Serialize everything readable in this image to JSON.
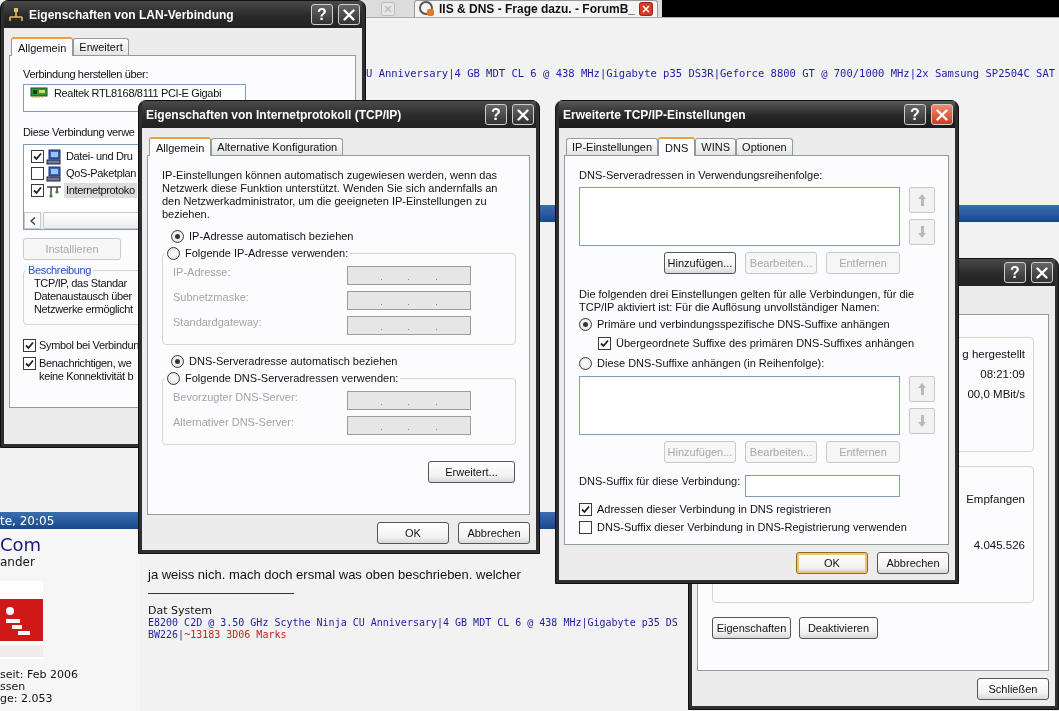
{
  "browser": {
    "tab_title": "IIS & DNS - Frage dazu. - ForumB_"
  },
  "forum": {
    "signature_fragment": "U Anniversary|4 GB MDT CL 6 @ 438 MHz|Gigabyte p35 DS3R|Geforce 8800 GT @ 700/1000 MHz|2x Samsung SP2504C SAT",
    "post_header": "te, 20:05",
    "user": {
      "name": "Com",
      "rank": "ander",
      "avatar": {
        "kind": "picture"
      },
      "details": [
        "seit: Feb 2006",
        "ssen",
        "ge: 2.053"
      ]
    },
    "post": {
      "text": "ja weiss nich. mach doch ersmal was oben beschrieben. welcher",
      "signature_title": "Dat System",
      "signature_lines": [
        {
          "segments": [
            {
              "text": "E8200 C2D @ 3.50 GHz Scythe Ninja CU Anniversary|4 GB MDT CL 6 @ 438 MHz|Gigabyte p35 DS",
              "color": "#1c1ca0"
            }
          ]
        },
        {
          "segments": [
            {
              "text": "BW226|",
              "color": "#1c1ca0"
            },
            {
              "text": "~13183 3D06 Marks",
              "color": "#c82020"
            }
          ]
        }
      ]
    }
  },
  "lan_window": {
    "title": "Eigenschaften von LAN-Verbindung",
    "active": false,
    "help": "?",
    "tabs": [
      {
        "label": "Allgemein",
        "selected": true
      },
      {
        "label": "Erweitert",
        "selected": false
      }
    ],
    "connect_label": "Verbindung herstellen über:",
    "adapter": "Realtek RTL8168/8111 PCI-E Gigabi",
    "components_label": "Diese Verbindung verwe",
    "components": [
      {
        "label": "Datei- und Dru",
        "kind": "computer",
        "checked": true,
        "selected": false
      },
      {
        "label": "QoS-Paketplan",
        "kind": "computer",
        "checked": false,
        "selected": false
      },
      {
        "label": "Internetprotoko",
        "kind": "protocol",
        "checked": true,
        "selected": true
      }
    ],
    "install_button": {
      "label": "Installieren",
      "disabled": true
    },
    "description": {
      "legend": "Beschreibung",
      "lines": [
        "TCP/IP, das Standar",
        "Datenaustausch über",
        "Netzwerke ermöglicht"
      ]
    },
    "options": [
      {
        "lines": [
          "Symbol bei Verbindun"
        ],
        "checked": true
      },
      {
        "lines": [
          "Benachrichtigen, we",
          "keine Konnektivität b"
        ],
        "checked": true
      }
    ]
  },
  "tcpip_window": {
    "title": "Eigenschaften von Internetprotokoll (TCP/IP)",
    "active": false,
    "help": "?",
    "tabs": [
      {
        "label": "Allgemein",
        "selected": true
      },
      {
        "label": "Alternative Konfiguration",
        "selected": false
      }
    ],
    "intro": "IP-Einstellungen können automatisch zugewiesen werden, wenn das Netzwerk diese Funktion unterstützt. Wenden Sie sich andernfalls an den Netzwerkadministrator, um die geeigneten IP-Einstellungen zu beziehen.",
    "ip_modes": [
      {
        "label": "IP-Adresse automatisch beziehen",
        "selected": true
      },
      {
        "label": "Folgende IP-Adresse verwenden:",
        "selected": false
      }
    ],
    "ip_fields": [
      {
        "label": "IP-Adresse:",
        "disabled": true
      },
      {
        "label": "Subnetzmaske:",
        "disabled": true
      },
      {
        "label": "Standardgateway:",
        "disabled": true
      }
    ],
    "dns_modes": [
      {
        "label": "DNS-Serveradresse automatisch beziehen",
        "selected": true
      },
      {
        "label": "Folgende DNS-Serveradressen verwenden:",
        "selected": false
      }
    ],
    "dns_fields": [
      {
        "label": "Bevorzugter DNS-Server:",
        "disabled": true
      },
      {
        "label": "Alternativer DNS-Server:",
        "disabled": true
      }
    ],
    "advanced_button": "Erweitert...",
    "buttons": [
      {
        "label": "OK",
        "default": false
      },
      {
        "label": "Abbrechen",
        "default": false
      }
    ]
  },
  "status_window": {
    "active": false,
    "help": "?",
    "status_values": [
      "g hergestellt",
      "08:21:09",
      "00,0 MBit/s"
    ],
    "activity_label": "Empfangen",
    "received": "4.045.526",
    "buttons": [
      {
        "label": "Eigenschaften"
      },
      {
        "label": "Deaktivieren"
      }
    ],
    "close_button": "Schließen"
  },
  "advanced_window": {
    "title": "Erweiterte TCP/IP-Einstellungen",
    "active": true,
    "help": "?",
    "tabs": [
      {
        "label": "IP-Einstellungen",
        "selected": false
      },
      {
        "label": "DNS",
        "selected": true
      },
      {
        "label": "WINS",
        "selected": false
      },
      {
        "label": "Optionen",
        "selected": false
      }
    ],
    "servers_label": "DNS-Serveradressen in Verwendungsreihenfolge:",
    "server_move_buttons": [
      {
        "kind": "up",
        "disabled": true
      },
      {
        "kind": "down",
        "disabled": true
      }
    ],
    "server_buttons": [
      {
        "label": "Hinzufügen...",
        "disabled": false
      },
      {
        "label": "Bearbeiten...",
        "disabled": true
      },
      {
        "label": "Entfernen",
        "disabled": true
      }
    ],
    "note": "Die folgenden drei Einstellungen gelten für alle Verbindungen, für die TCP/IP aktiviert ist: Für die Auflösung unvollständiger Namen:",
    "suffix_modes": [
      {
        "label": "Primäre und verbindungsspezifische DNS-Suffixe anhängen",
        "selected": true
      },
      {
        "label": "Diese DNS-Suffixe anhängen (in Reihenfolge):",
        "selected": false
      }
    ],
    "parent_suffix": {
      "label": "Übergeordnete Suffixe des primären DNS-Suffixes anhängen",
      "checked": true
    },
    "suffix_move_buttons": [
      {
        "kind": "up",
        "disabled": true
      },
      {
        "kind": "down",
        "disabled": true
      }
    ],
    "suffix_buttons": [
      {
        "label": "Hinzufügen...",
        "disabled": true
      },
      {
        "label": "Bearbeiten...",
        "disabled": true
      },
      {
        "label": "Entfernen",
        "disabled": true
      }
    ],
    "connection_suffix_label": "DNS-Suffix für diese Verbindung:",
    "registration": [
      {
        "label": "Adressen dieser Verbindung in DNS registrieren",
        "checked": true
      },
      {
        "label": "DNS-Suffix dieser Verbindung in DNS-Registrierung verwenden",
        "checked": false
      }
    ],
    "buttons": [
      {
        "label": "OK",
        "default": true
      },
      {
        "label": "Abbrechen",
        "default": false
      }
    ]
  }
}
